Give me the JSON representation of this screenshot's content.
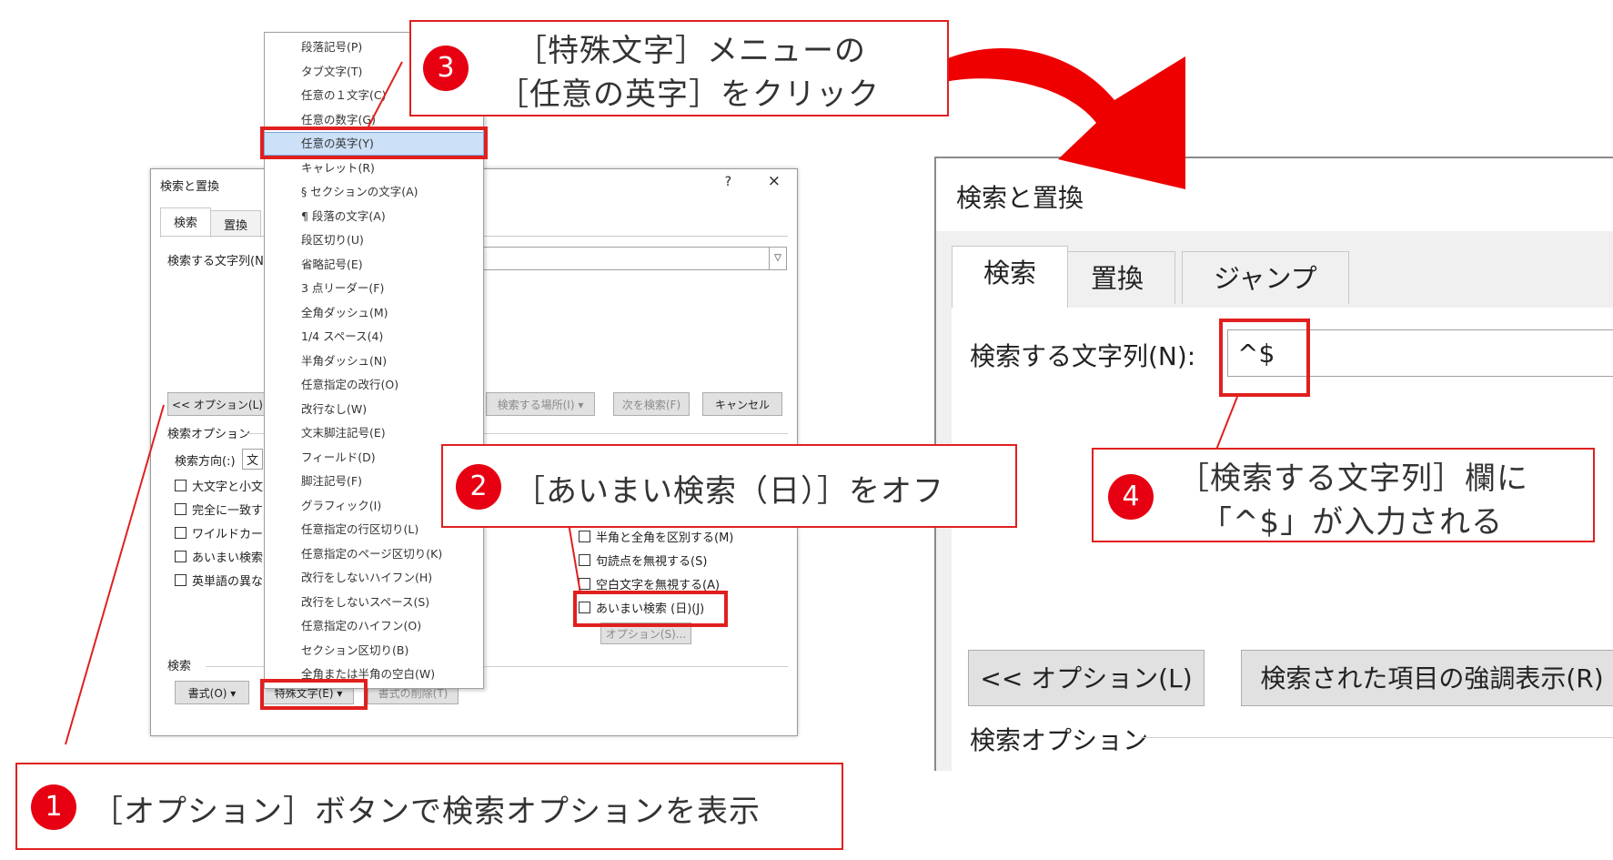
{
  "left_dialog": {
    "title": "検索と置換",
    "help": "?",
    "close": "×",
    "tabs": [
      "検索",
      "置換"
    ],
    "find_label": "検索する文字列(N",
    "options_button": "<< オプション(L)",
    "search_in_button": "検索する場所(I) ▾",
    "find_next_button": "次を検索(F)",
    "cancel_button": "キャンセル",
    "search_options_label": "検索オプション",
    "direction_label": "検索方向(:)",
    "direction_value": "文",
    "checkboxes_left": [
      "大文字と小文",
      "完全に一致す",
      "ワイルドカード",
      "あいまい検索",
      "英単語の異な"
    ],
    "checkboxes_right": [
      "半角と全角を区別する(M)",
      "句読点を無視する(S)",
      "空白文字を無視する(A)",
      "あいまい検索 (日)(J)"
    ],
    "options_s_button": "オプション(S)...",
    "search_section_label": "検索",
    "format_button": "書式(O) ▾",
    "special_button": "特殊文字(E) ▾",
    "clear_format_button": "書式の削除(T)"
  },
  "menu": {
    "items": [
      "段落記号(P)",
      "タブ文字(T)",
      "任意の１文字(C)",
      "任意の数字(G)",
      "任意の英字(Y)",
      "キャレット(R)",
      "§ セクションの文字(A)",
      "¶ 段落の文字(A)",
      "段区切り(U)",
      "省略記号(E)",
      "3 点リーダー(F)",
      "全角ダッシュ(M)",
      "1/4 スペース(4)",
      "半角ダッシュ(N)",
      "任意指定の改行(O)",
      "改行なし(W)",
      "文末脚注記号(E)",
      "フィールド(D)",
      "脚注記号(F)",
      "グラフィック(I)",
      "任意指定の行区切り(L)",
      "任意指定のページ区切り(K)",
      "改行をしないハイフン(H)",
      "改行をしないスペース(S)",
      "任意指定のハイフン(O)",
      "セクション区切り(B)",
      "全角または半角の空白(W)"
    ],
    "highlighted_index": 4
  },
  "right_dialog": {
    "title": "検索と置換",
    "tabs": [
      "検索",
      "置換",
      "ジャンプ"
    ],
    "find_label": "検索する文字列(N):",
    "find_value": "^$",
    "options_button": "<< オプション(L)",
    "highlight_button": "検索された項目の強調表示(R)",
    "search_options_label": "検索オプション"
  },
  "callouts": {
    "c1": {
      "num": "1",
      "text": "［オプション］ボタンで検索オプションを表示"
    },
    "c2": {
      "num": "2",
      "text": "［あいまい検索（日）］をオフ"
    },
    "c3": {
      "num": "3",
      "line1": "［特殊文字］メニューの",
      "line2": "［任意の英字］をクリック"
    },
    "c4": {
      "num": "4",
      "line1": "［検索する文字列］欄に",
      "line2": "「^$」が入力される"
    }
  },
  "colors": {
    "accent_red": "#e60012",
    "highlight_blue": "#cce0f7"
  }
}
